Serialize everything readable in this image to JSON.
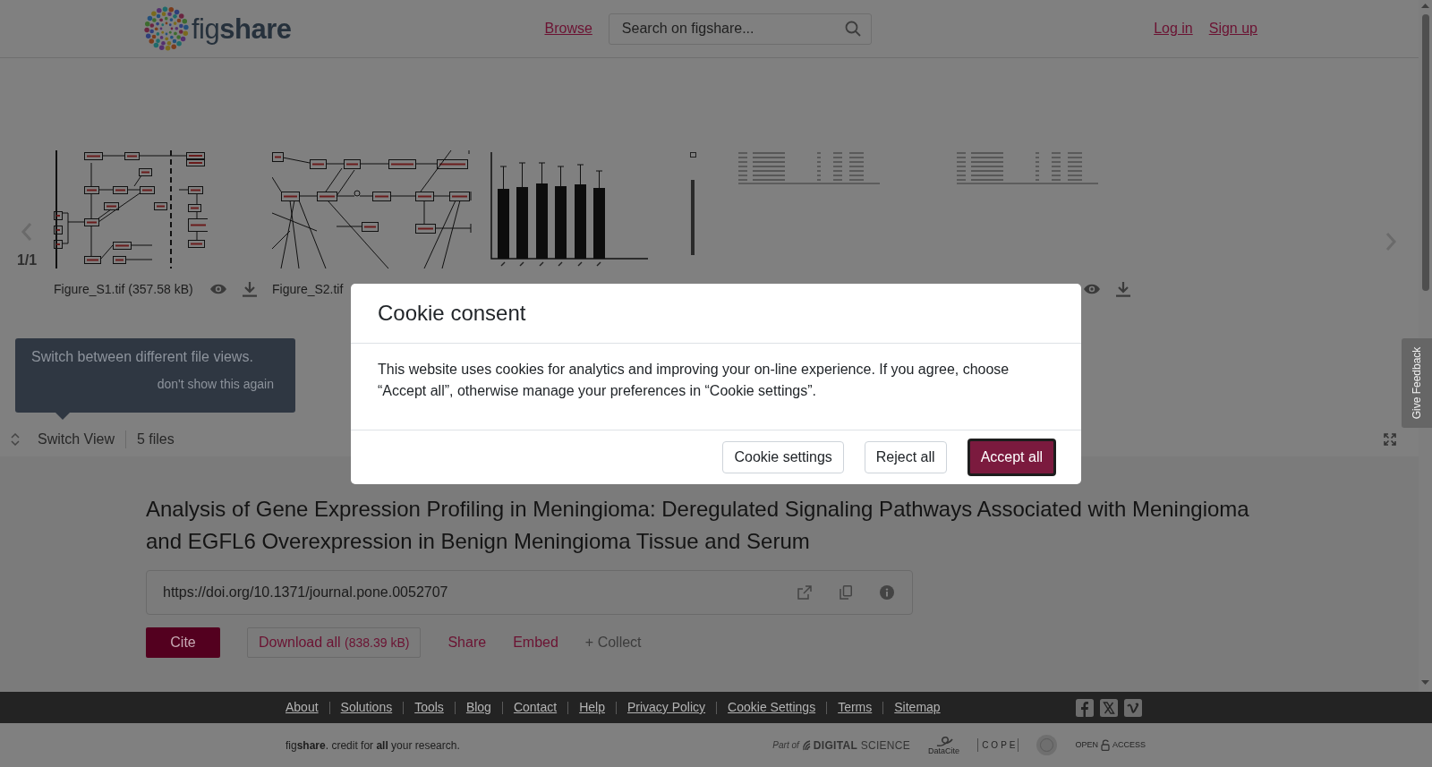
{
  "header": {
    "logo": "fig**share**",
    "nav_link": "Browse",
    "search": {
      "placeholder": "Search on figshare..."
    },
    "account_links": [
      "Log in",
      "Sign up"
    ]
  },
  "viewer": {
    "pager": "1/1",
    "files": [
      {
        "kind": "pathway",
        "caption": "Figure_S1.tif (357.58 kB)",
        "actions": true
      },
      {
        "kind": "pathway",
        "caption": "Figure_S2.tif",
        "actions": false
      },
      {
        "kind": "bar_plot",
        "actions": false
      },
      {
        "kind": "table",
        "actions": false
      },
      {
        "kind": "table",
        "actions": true
      }
    ],
    "tooltip": {
      "text": "Switch between different file views.",
      "dismiss": "don't show this again"
    },
    "toolbar": {
      "switch_view": "Switch View",
      "file_count": "5 files"
    }
  },
  "feedback_tab": "Give Feedback",
  "article": {
    "title": "Analysis of Gene Expression Profiling in Meningioma: Deregulated Signaling Pathways Associated with Meningioma and EGFL6 Overexpression in Benign Meningioma Tissue and Serum",
    "doi": "https://doi.org/10.1371/journal.pone.0052707",
    "actions": [
      {
        "kind": "primary",
        "label": "Cite"
      },
      {
        "kind": "outline",
        "label": "Download all",
        "size": "(838.39 kB)"
      },
      {
        "kind": "link",
        "label": "Share"
      },
      {
        "kind": "link",
        "label": "Embed"
      },
      {
        "kind": "muted",
        "label": "+ Collect"
      }
    ]
  },
  "footer": {
    "links": [
      "About",
      "Solutions",
      "Tools",
      "Blog",
      "Contact",
      "Help",
      "Privacy Policy",
      "Cookie Settings",
      "Terms",
      "Sitemap"
    ],
    "tagline": "fig**share**. credit for **all** your research.",
    "partners": [
      {
        "kind": "digital_science",
        "label": "Part of",
        "name": "**DIGITAL** SCIENCE"
      },
      {
        "kind": "datacite",
        "label": "DataCite"
      },
      {
        "kind": "cope",
        "label": "COPE"
      },
      {
        "kind": "seal"
      },
      {
        "kind": "open_access",
        "label": "OPEN",
        "name": "ACCESS"
      }
    ]
  },
  "cookie_dialog": {
    "title": "Cookie consent",
    "body": "This website uses cookies for analytics and improving your on-line experience. If you agree, choose “Accept all”, otherwise manage your preferences in “Cookie settings”.",
    "buttons": [
      {
        "kind": "secondary",
        "label": "Cookie settings",
        "focused": false
      },
      {
        "kind": "secondary",
        "label": "Reject all",
        "focused": false
      },
      {
        "kind": "primary",
        "label": "Accept all",
        "focused": true
      }
    ]
  }
}
